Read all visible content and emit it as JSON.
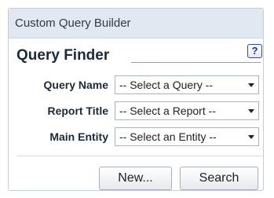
{
  "panel": {
    "title": "Custom Query Builder"
  },
  "finder": {
    "title": "Query Finder",
    "help_icon": "help-icon",
    "help_glyph": "?"
  },
  "fields": [
    {
      "label": "Query Name",
      "value": "-- Select a Query --"
    },
    {
      "label": "Report Title",
      "value": "-- Select a Report --"
    },
    {
      "label": "Main Entity",
      "value": "-- Select an Entity --"
    }
  ],
  "buttons": {
    "new_label": "New...",
    "search_label": "Search"
  }
}
